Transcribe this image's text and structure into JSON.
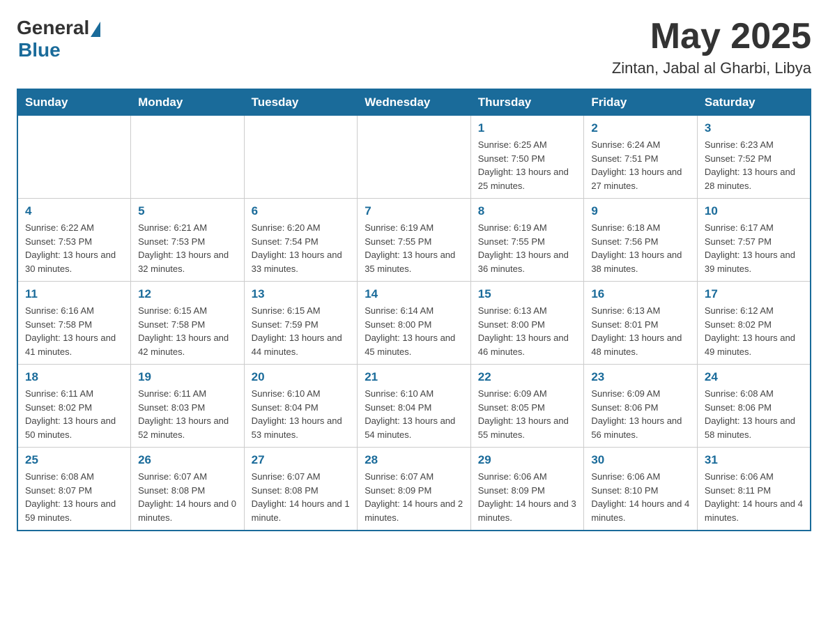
{
  "header": {
    "logo_general": "General",
    "logo_blue": "Blue",
    "month_title": "May 2025",
    "location": "Zintan, Jabal al Gharbi, Libya"
  },
  "weekdays": [
    "Sunday",
    "Monday",
    "Tuesday",
    "Wednesday",
    "Thursday",
    "Friday",
    "Saturday"
  ],
  "weeks": [
    [
      {
        "day": "",
        "info": ""
      },
      {
        "day": "",
        "info": ""
      },
      {
        "day": "",
        "info": ""
      },
      {
        "day": "",
        "info": ""
      },
      {
        "day": "1",
        "info": "Sunrise: 6:25 AM\nSunset: 7:50 PM\nDaylight: 13 hours and 25 minutes."
      },
      {
        "day": "2",
        "info": "Sunrise: 6:24 AM\nSunset: 7:51 PM\nDaylight: 13 hours and 27 minutes."
      },
      {
        "day": "3",
        "info": "Sunrise: 6:23 AM\nSunset: 7:52 PM\nDaylight: 13 hours and 28 minutes."
      }
    ],
    [
      {
        "day": "4",
        "info": "Sunrise: 6:22 AM\nSunset: 7:53 PM\nDaylight: 13 hours and 30 minutes."
      },
      {
        "day": "5",
        "info": "Sunrise: 6:21 AM\nSunset: 7:53 PM\nDaylight: 13 hours and 32 minutes."
      },
      {
        "day": "6",
        "info": "Sunrise: 6:20 AM\nSunset: 7:54 PM\nDaylight: 13 hours and 33 minutes."
      },
      {
        "day": "7",
        "info": "Sunrise: 6:19 AM\nSunset: 7:55 PM\nDaylight: 13 hours and 35 minutes."
      },
      {
        "day": "8",
        "info": "Sunrise: 6:19 AM\nSunset: 7:55 PM\nDaylight: 13 hours and 36 minutes."
      },
      {
        "day": "9",
        "info": "Sunrise: 6:18 AM\nSunset: 7:56 PM\nDaylight: 13 hours and 38 minutes."
      },
      {
        "day": "10",
        "info": "Sunrise: 6:17 AM\nSunset: 7:57 PM\nDaylight: 13 hours and 39 minutes."
      }
    ],
    [
      {
        "day": "11",
        "info": "Sunrise: 6:16 AM\nSunset: 7:58 PM\nDaylight: 13 hours and 41 minutes."
      },
      {
        "day": "12",
        "info": "Sunrise: 6:15 AM\nSunset: 7:58 PM\nDaylight: 13 hours and 42 minutes."
      },
      {
        "day": "13",
        "info": "Sunrise: 6:15 AM\nSunset: 7:59 PM\nDaylight: 13 hours and 44 minutes."
      },
      {
        "day": "14",
        "info": "Sunrise: 6:14 AM\nSunset: 8:00 PM\nDaylight: 13 hours and 45 minutes."
      },
      {
        "day": "15",
        "info": "Sunrise: 6:13 AM\nSunset: 8:00 PM\nDaylight: 13 hours and 46 minutes."
      },
      {
        "day": "16",
        "info": "Sunrise: 6:13 AM\nSunset: 8:01 PM\nDaylight: 13 hours and 48 minutes."
      },
      {
        "day": "17",
        "info": "Sunrise: 6:12 AM\nSunset: 8:02 PM\nDaylight: 13 hours and 49 minutes."
      }
    ],
    [
      {
        "day": "18",
        "info": "Sunrise: 6:11 AM\nSunset: 8:02 PM\nDaylight: 13 hours and 50 minutes."
      },
      {
        "day": "19",
        "info": "Sunrise: 6:11 AM\nSunset: 8:03 PM\nDaylight: 13 hours and 52 minutes."
      },
      {
        "day": "20",
        "info": "Sunrise: 6:10 AM\nSunset: 8:04 PM\nDaylight: 13 hours and 53 minutes."
      },
      {
        "day": "21",
        "info": "Sunrise: 6:10 AM\nSunset: 8:04 PM\nDaylight: 13 hours and 54 minutes."
      },
      {
        "day": "22",
        "info": "Sunrise: 6:09 AM\nSunset: 8:05 PM\nDaylight: 13 hours and 55 minutes."
      },
      {
        "day": "23",
        "info": "Sunrise: 6:09 AM\nSunset: 8:06 PM\nDaylight: 13 hours and 56 minutes."
      },
      {
        "day": "24",
        "info": "Sunrise: 6:08 AM\nSunset: 8:06 PM\nDaylight: 13 hours and 58 minutes."
      }
    ],
    [
      {
        "day": "25",
        "info": "Sunrise: 6:08 AM\nSunset: 8:07 PM\nDaylight: 13 hours and 59 minutes."
      },
      {
        "day": "26",
        "info": "Sunrise: 6:07 AM\nSunset: 8:08 PM\nDaylight: 14 hours and 0 minutes."
      },
      {
        "day": "27",
        "info": "Sunrise: 6:07 AM\nSunset: 8:08 PM\nDaylight: 14 hours and 1 minute."
      },
      {
        "day": "28",
        "info": "Sunrise: 6:07 AM\nSunset: 8:09 PM\nDaylight: 14 hours and 2 minutes."
      },
      {
        "day": "29",
        "info": "Sunrise: 6:06 AM\nSunset: 8:09 PM\nDaylight: 14 hours and 3 minutes."
      },
      {
        "day": "30",
        "info": "Sunrise: 6:06 AM\nSunset: 8:10 PM\nDaylight: 14 hours and 4 minutes."
      },
      {
        "day": "31",
        "info": "Sunrise: 6:06 AM\nSunset: 8:11 PM\nDaylight: 14 hours and 4 minutes."
      }
    ]
  ]
}
